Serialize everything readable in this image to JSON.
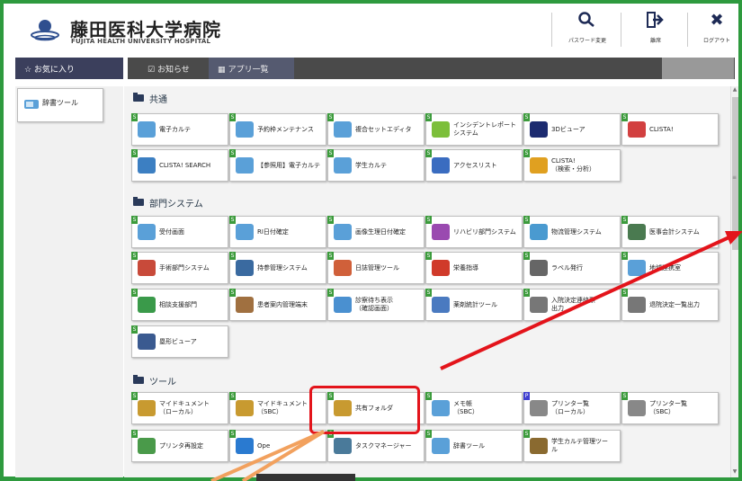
{
  "header": {
    "title": "藤田医科大学病院",
    "subtitle": "FUJITA HEALTH UNIVERSITY HOSPITAL",
    "buttons": [
      {
        "label": "パスワード変更",
        "icon": "key-search-icon"
      },
      {
        "label": "離席",
        "icon": "leave-arrow-icon"
      },
      {
        "label": "ログアウト",
        "icon": "close-icon"
      }
    ]
  },
  "nav": {
    "favorites_tab": "☆ お気に入り",
    "notice_tab": "お知らせ",
    "apps_tab": "アプリ一覧"
  },
  "favorites": [
    {
      "label": "辞書ツール"
    }
  ],
  "sections": [
    {
      "title": "共通"
    },
    {
      "title": "部門システム"
    },
    {
      "title": "ツール"
    }
  ],
  "tiles_common": [
    {
      "label": "電子カルテ",
      "color": "#5aa0d8"
    },
    {
      "label": "予約枠メンテナンス",
      "color": "#5aa0d8"
    },
    {
      "label": "複合セットエディタ",
      "color": "#5aa0d8"
    },
    {
      "label": "インシデントレポート\nシステム",
      "color": "#7cbf3a"
    },
    {
      "label": "3Dビューア",
      "color": "#1c2b70"
    },
    {
      "label": "CLISTA!",
      "color": "#d24040"
    },
    {
      "label": "CLISTA! SEARCH",
      "color": "#3c7fc2"
    },
    {
      "label": "【参照用】電子カルテ",
      "color": "#5aa0d8"
    },
    {
      "label": "学生カルテ",
      "color": "#5aa0d8"
    },
    {
      "label": "アクセスリスト",
      "color": "#3a6cc0"
    },
    {
      "label": "CLISTA!\n（検索・分析）",
      "color": "#e0a020"
    }
  ],
  "tiles_dept": [
    {
      "label": "受付画面",
      "color": "#5aa0d8"
    },
    {
      "label": "RI日付確定",
      "color": "#5aa0d8"
    },
    {
      "label": "画像生理日付確定",
      "color": "#5aa0d8"
    },
    {
      "label": "リハビリ部門システム",
      "color": "#9a4ab0"
    },
    {
      "label": "物流管理システム",
      "color": "#4a9ad0"
    },
    {
      "label": "医事会計システム",
      "color": "#4a7a50"
    },
    {
      "label": "手術部門システム",
      "color": "#c84a3a"
    },
    {
      "label": "持参管理システム",
      "color": "#3a6aa0"
    },
    {
      "label": "日誌管理ツール",
      "color": "#d0603a"
    },
    {
      "label": "栄養指導",
      "color": "#d03a2a"
    },
    {
      "label": "ラベル発行",
      "color": "#666666"
    },
    {
      "label": "地域連携室",
      "color": "#5aa0d8"
    },
    {
      "label": "相談支援部門",
      "color": "#3a9a4a"
    },
    {
      "label": "患者案内管理端末",
      "color": "#a07040"
    },
    {
      "label": "診察待ち表示\n（確認画面）",
      "color": "#4a90d0"
    },
    {
      "label": "薬剤統計ツール",
      "color": "#4a7ac0"
    },
    {
      "label": "入院決定連絡票\n出力",
      "color": "#777777"
    },
    {
      "label": "退院決定一覧出力",
      "color": "#777777"
    },
    {
      "label": "塁形ビューア",
      "color": "#3a5a90"
    }
  ],
  "tiles_tools": [
    {
      "label": "マイドキュメント\n（ローカル）",
      "color": "#c89a30"
    },
    {
      "label": "マイドキュメント\n（SBC）",
      "color": "#c89a30"
    },
    {
      "label": "共有フォルダ",
      "color": "#c89a30"
    },
    {
      "label": "メモ帳\n（SBC）",
      "color": "#5aa0d8"
    },
    {
      "label": "プリンター覧\n（ローカル）",
      "color": "#888888"
    },
    {
      "label": "プリンター覧\n（SBC）",
      "color": "#888888"
    },
    {
      "label": "プリンタ再設定",
      "color": "#4a9a4a"
    },
    {
      "label": "Ope",
      "color": "#2a7ad0"
    },
    {
      "label": "タスクマネージャー",
      "color": "#4a7a9a"
    },
    {
      "label": "辞書ツール",
      "color": "#5aa0d8"
    },
    {
      "label": "学生カルテ管理ツー\nル",
      "color": "#8a6a30"
    }
  ],
  "colors": {
    "frame": "#2e9a3e",
    "highlight": "#e3141b",
    "arrow_red": "#e3141b",
    "arrow_orange": "#f2a15e"
  }
}
